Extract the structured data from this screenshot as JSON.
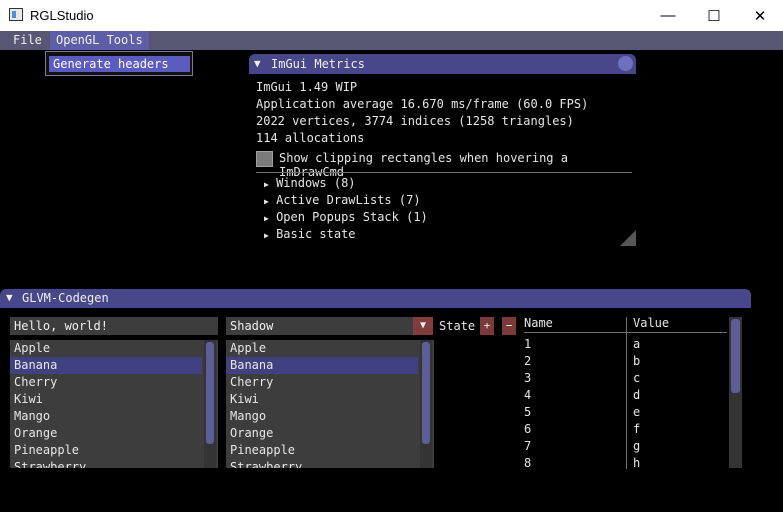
{
  "window": {
    "title": "RGLStudio",
    "minimize_glyph": "—",
    "maximize_glyph": "☐",
    "close_glyph": "✕"
  },
  "menu": {
    "items": [
      "File",
      "OpenGL Tools"
    ],
    "dropdown_item": "Generate headers"
  },
  "metrics": {
    "title": "ImGui Metrics",
    "lines": [
      "ImGui 1.49 WIP",
      "Application average 16.670 ms/frame (60.0 FPS)",
      "2022 vertices, 3774 indices (1258 triangles)",
      "114 allocations"
    ],
    "checkbox_label": "Show clipping rectangles when hovering a ImDrawCmd",
    "tree_nodes": [
      "Windows (8)",
      "Active DrawLists (7)",
      "Open Popups Stack (1)",
      "Basic state"
    ]
  },
  "codegen": {
    "title": "GLVM-Codegen",
    "text_input": "Hello, world!",
    "combo_value": "Shadow",
    "list_items": [
      "Apple",
      "Banana",
      "Cherry",
      "Kiwi",
      "Mango",
      "Orange",
      "Pineapple",
      "Strawberry"
    ],
    "selected_index": 1,
    "state_label": "State",
    "plus_label": "+",
    "minus_label": "−",
    "table": {
      "headers": [
        "Name",
        "Value"
      ],
      "rows": [
        [
          "1",
          "a"
        ],
        [
          "2",
          "b"
        ],
        [
          "3",
          "c"
        ],
        [
          "4",
          "d"
        ],
        [
          "5",
          "e"
        ],
        [
          "6",
          "f"
        ],
        [
          "7",
          "g"
        ],
        [
          "8",
          "h"
        ]
      ]
    }
  },
  "colors": {
    "title_bar": "#474789",
    "menu_bar": "#575774",
    "highlight": "#5b5bc0",
    "widget_bg": "#3d3d3d",
    "button_red": "#7a3a3a"
  }
}
